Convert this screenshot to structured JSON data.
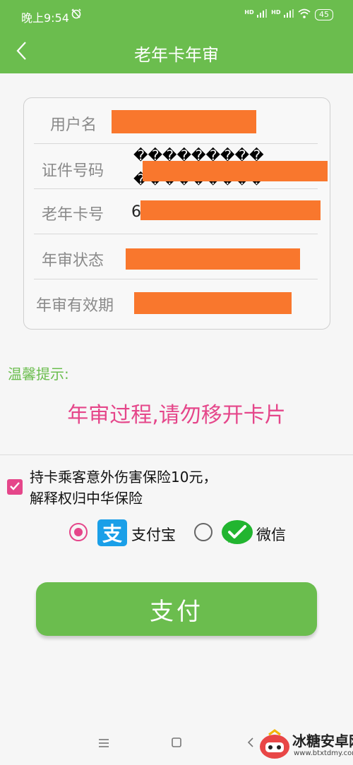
{
  "status_bar": {
    "time": "晚上9:54",
    "signal_label_1": "HD",
    "signal_label_2": "HD",
    "battery": "45"
  },
  "header": {
    "title": "老年卡年审",
    "back_icon": "chevron-left-icon"
  },
  "info": {
    "username_label": "用户名",
    "id_label": "证件号码",
    "id_value_garbled_line1": "���������",
    "id_value_garbled_line2": "���������",
    "card_label": "老年卡号",
    "card_prefix": "6",
    "status_label": "年审状态",
    "validity_label": "年审有效期"
  },
  "tips": {
    "title": "温馨提示:",
    "message": "年审过程,请勿移开卡片"
  },
  "insurance": {
    "checked": true,
    "line1": "持卡乘客意外伤害保险10元，",
    "line2": "解释权归中华保险"
  },
  "payment": {
    "alipay_label": "支付宝",
    "wechat_label": "微信",
    "selected": "alipay",
    "pay_button": "支付"
  },
  "watermark": {
    "text": "冰糖安卓网",
    "url": "www.btxtdmy.com"
  },
  "colors": {
    "primary_green": "#6bbd4e",
    "accent_pink": "#e5468a",
    "redaction_orange": "#f9772d",
    "alipay_blue": "#1a9fe8",
    "wechat_green": "#22b530"
  }
}
